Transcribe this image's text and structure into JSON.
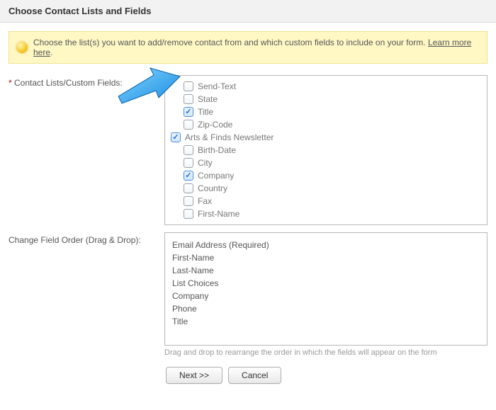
{
  "header": {
    "title": "Choose Contact Lists and Fields"
  },
  "info": {
    "text": "Choose the list(s) you want to add/remove contact from and which custom fields to include on your form. ",
    "link": "Learn more here"
  },
  "labels": {
    "contact_lists": "Contact Lists/Custom Fields:",
    "change_order": "Change Field Order (Drag & Drop):"
  },
  "checklist": {
    "items": [
      {
        "label": "Send-Text",
        "checked": false,
        "indent": true
      },
      {
        "label": "State",
        "checked": false,
        "indent": true
      },
      {
        "label": "Title",
        "checked": true,
        "indent": true
      },
      {
        "label": "Zip-Code",
        "checked": false,
        "indent": true
      },
      {
        "label": "Arts & Finds Newsletter",
        "checked": true,
        "indent": false
      },
      {
        "label": "Birth-Date",
        "checked": false,
        "indent": true
      },
      {
        "label": "City",
        "checked": false,
        "indent": true
      },
      {
        "label": "Company",
        "checked": true,
        "indent": true
      },
      {
        "label": "Country",
        "checked": false,
        "indent": true
      },
      {
        "label": "Fax",
        "checked": false,
        "indent": true
      },
      {
        "label": "First-Name",
        "checked": false,
        "indent": true
      }
    ]
  },
  "order": {
    "items": [
      "Email Address (Required)",
      "First-Name",
      "Last-Name",
      "List Choices",
      "Company",
      "Phone",
      "Title"
    ],
    "hint": "Drag and drop to rearrange the order in which the fields will appear on the form"
  },
  "buttons": {
    "next": "Next >>",
    "cancel": "Cancel"
  },
  "chart_data": null
}
